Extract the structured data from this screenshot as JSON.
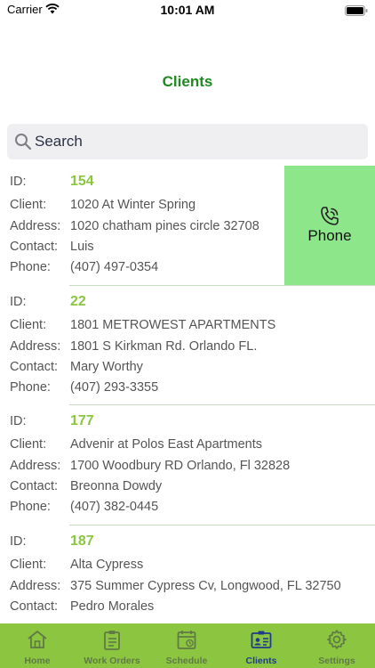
{
  "status_bar": {
    "carrier": "Carrier",
    "time": "10:01 AM"
  },
  "header": {
    "title": "Clients"
  },
  "search": {
    "placeholder": "Search"
  },
  "labels": {
    "id": "ID:",
    "client": "Client:",
    "address": "Address:",
    "contact": "Contact:",
    "phone": "Phone:"
  },
  "clients": [
    {
      "id": "154",
      "client": "1020 At Winter Spring",
      "address": "1020 chatham pines circle 32708",
      "contact": "Luis",
      "phone": "(407) 497-0354"
    },
    {
      "id": "22",
      "client": "1801 METROWEST APARTMENTS",
      "address": "1801 S Kirkman Rd. Orlando FL.",
      "contact": "Mary Worthy",
      "phone": "(407) 293-3355"
    },
    {
      "id": "177",
      "client": "Advenir at Polos East Apartments",
      "address": "1700 Woodbury RD Orlando, Fl 32828",
      "contact": "Breonna Dowdy",
      "phone": "(407) 382-0445"
    },
    {
      "id": "187",
      "client": "Alta Cypress",
      "address": "375 Summer Cypress Cv, Longwood, FL 32750",
      "contact": "Pedro Morales"
    }
  ],
  "swipe_action": {
    "label": "Phone",
    "icon": "phone-icon",
    "color": "#8ee68a"
  },
  "tab_bar": {
    "background": "#8cc641",
    "tabs": [
      {
        "label": "Home",
        "icon": "home-icon"
      },
      {
        "label": "Work Orders",
        "icon": "clipboard-icon"
      },
      {
        "label": "Schedule",
        "icon": "calendar-icon"
      },
      {
        "label": "Clients",
        "icon": "id-card-icon",
        "active": true
      },
      {
        "label": "Settings",
        "icon": "gear-icon"
      }
    ]
  }
}
